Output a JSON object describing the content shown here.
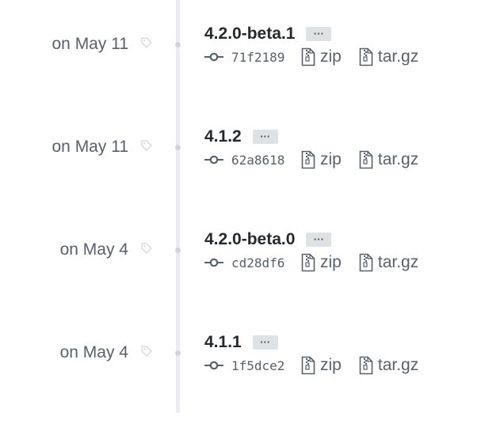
{
  "releases": [
    {
      "date": "on May 11",
      "title": "4.2.0-beta.1",
      "more_label": "···",
      "sha": "71f2189",
      "zip_label": "zip",
      "tar_label": "tar.gz"
    },
    {
      "date": "on May 11",
      "title": "4.1.2",
      "more_label": "···",
      "sha": "62a8618",
      "zip_label": "zip",
      "tar_label": "tar.gz"
    },
    {
      "date": "on May 4",
      "title": "4.2.0-beta.0",
      "more_label": "···",
      "sha": "cd28df6",
      "zip_label": "zip",
      "tar_label": "tar.gz"
    },
    {
      "date": "on May 4",
      "title": "4.1.1",
      "more_label": "···",
      "sha": "1f5dce2",
      "zip_label": "zip",
      "tar_label": "tar.gz"
    }
  ],
  "icons": {
    "tag": "tag-icon",
    "commit": "git-commit-icon",
    "file_zip": "file-zip-icon"
  },
  "colors": {
    "muted": "#586069",
    "text": "#24292e",
    "timeline": "#eaecef",
    "ellipsis_bg": "#dfe2e5"
  }
}
